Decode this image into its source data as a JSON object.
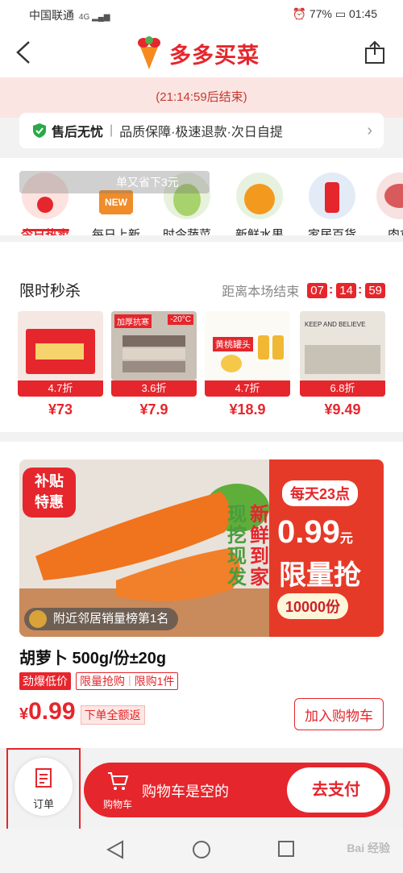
{
  "status_bar": {
    "carrier": "中国联通",
    "network": "4G",
    "battery": "77%",
    "time": "01:45"
  },
  "header": {
    "title": "多多买菜"
  },
  "countdown_strip": "(21:14:59后结束)",
  "guarantee": {
    "title": "售后无忧",
    "desc": "品质保障·极速退款·次日自提"
  },
  "bubble_text": "单又省下3元",
  "categories": [
    {
      "label": "今日热卖",
      "active": true
    },
    {
      "label": "每日上新",
      "badge": "NEW"
    },
    {
      "label": "时令蔬菜"
    },
    {
      "label": "新鲜水果"
    },
    {
      "label": "家居百货"
    },
    {
      "label": "肉禽"
    }
  ],
  "flash_sale": {
    "title": "限时秒杀",
    "timer_label": "距离本场结束",
    "h": "07",
    "m": "14",
    "s": "59",
    "items": [
      {
        "discount": "4.7折",
        "price": "¥73"
      },
      {
        "discount": "3.6折",
        "price": "¥7.9",
        "img_text": "加厚抗寒",
        "img_badge": "-20°C"
      },
      {
        "discount": "4.7折",
        "price": "¥18.9",
        "img_text": "黄桃罐头"
      },
      {
        "discount": "6.8折",
        "price": "¥9.49",
        "img_text": "KEEP AND BELIEVE"
      }
    ]
  },
  "product": {
    "badge_line1": "补贴",
    "badge_line2": "特惠",
    "rank": "附近邻居销量榜第1名",
    "vertical_text_1": "现挖现发",
    "vertical_text_2": "新鲜到家",
    "promo_day": "每天23点",
    "promo_price": "0.99",
    "promo_unit": "元",
    "promo_limit": "限量抢",
    "promo_count": "10000份",
    "name": "胡萝卜 500g/份±20g",
    "tag_hot": "劲爆低价",
    "tag_limit_a": "限量抢购",
    "tag_limit_b": "限购1件",
    "price_symbol": "¥",
    "price": "0.99",
    "price_note": "下单全额返",
    "add_to_cart": "加入购物车"
  },
  "bottom": {
    "order_label": "订单",
    "cart_label": "购物车",
    "cart_empty": "购物车是空的",
    "pay": "去支付"
  },
  "watermark": "Bai 经验"
}
